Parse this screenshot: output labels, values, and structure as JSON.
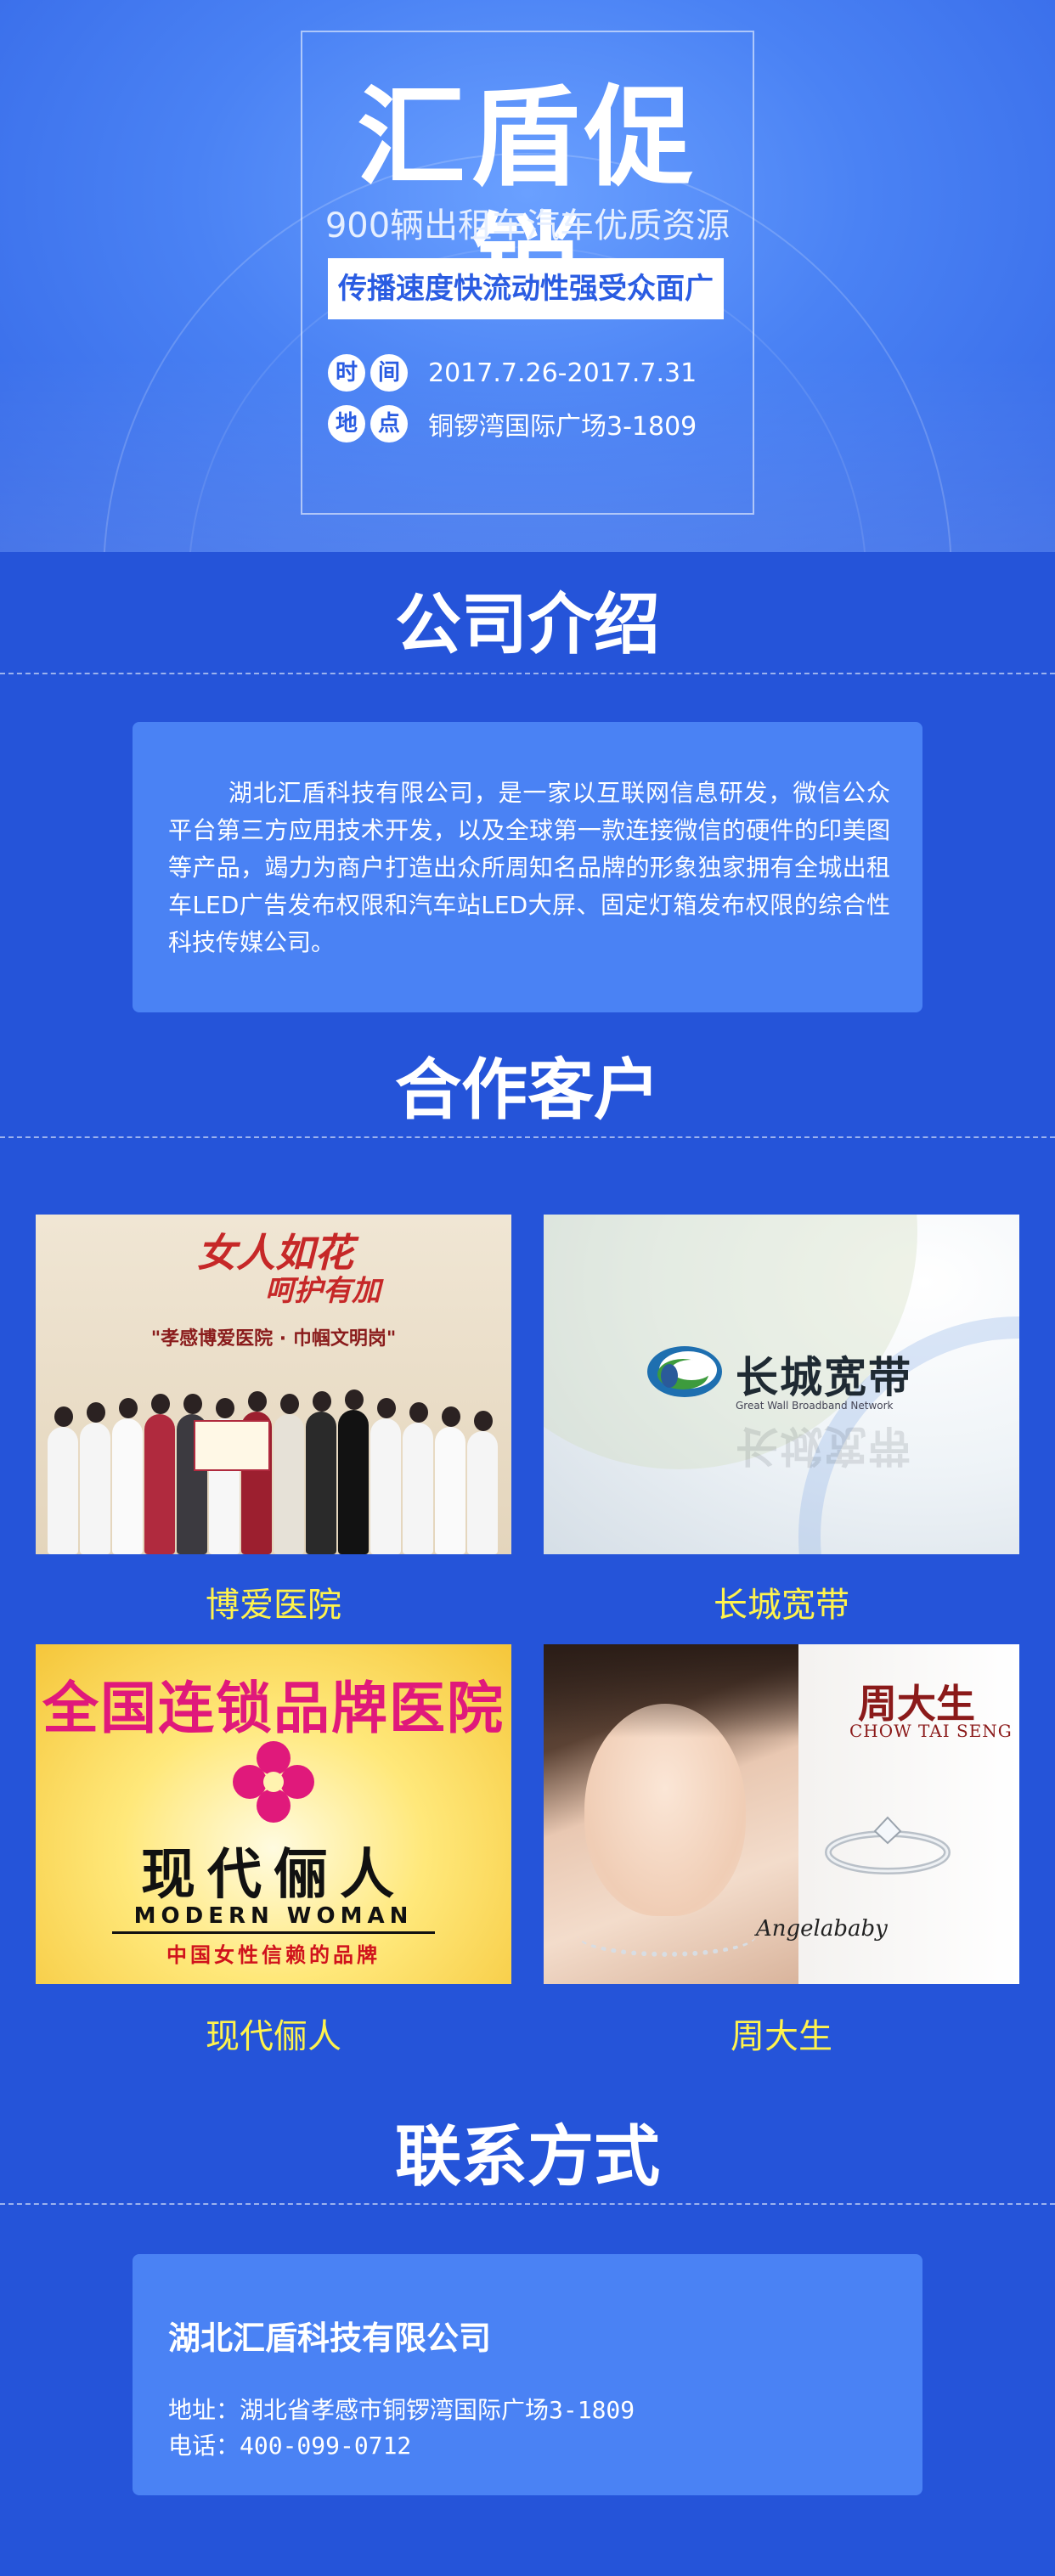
{
  "hero": {
    "title": "汇盾促销",
    "subtitle": "900辆出租车汽车优质资源",
    "tag": "传播速度快流动性强受众面广",
    "time_chip_1": "时",
    "time_chip_2": "间",
    "time_value": "2017.7.26-2017.7.31",
    "place_chip_1": "地",
    "place_chip_2": "点",
    "place_value": "铜锣湾国际广场3-1809"
  },
  "intro": {
    "title": "公司介绍",
    "text": "湖北汇盾科技有限公司，是一家以互联网信息研发，微信公众平台第三方应用技术开发，以及全球第一款连接微信的硬件的印美图等产品，竭力为商户打造出众所周知名品牌的形象独家拥有全城出租车LED广告发布权限和汽车站LED大屏、固定灯箱发布权限的综合性科技传媒公司。"
  },
  "partners": {
    "title": "合作客户",
    "items": [
      {
        "name": "博爱医院",
        "headline": "女人如花",
        "headline2": "呵护有加",
        "sub": "\"孝感博爱医院 · 巾帼文明岗\""
      },
      {
        "name": "长城宽带",
        "logo_text": "长城宽带",
        "logo_en": "Great Wall   Broadband Network"
      },
      {
        "name": "现代俪人",
        "arc_text": "全国连锁品牌医院",
        "cn": "现代俪人",
        "en": "MODERN WOMAN",
        "slogan": "中国女性信赖的品牌"
      },
      {
        "name": "周大生",
        "brand": "周大生",
        "brand_en": "CHOW TAI SENG",
        "signature": "Angelababy"
      }
    ]
  },
  "contact": {
    "title": "联系方式",
    "company": "湖北汇盾科技有限公司",
    "address": "地址：湖北省孝感市铜锣湾国际广场3-1809",
    "phone": "电话：400-099-0712"
  },
  "colors": {
    "background": "#2554d9",
    "card": "#4a82f4",
    "partner_name": "#fff34d"
  }
}
